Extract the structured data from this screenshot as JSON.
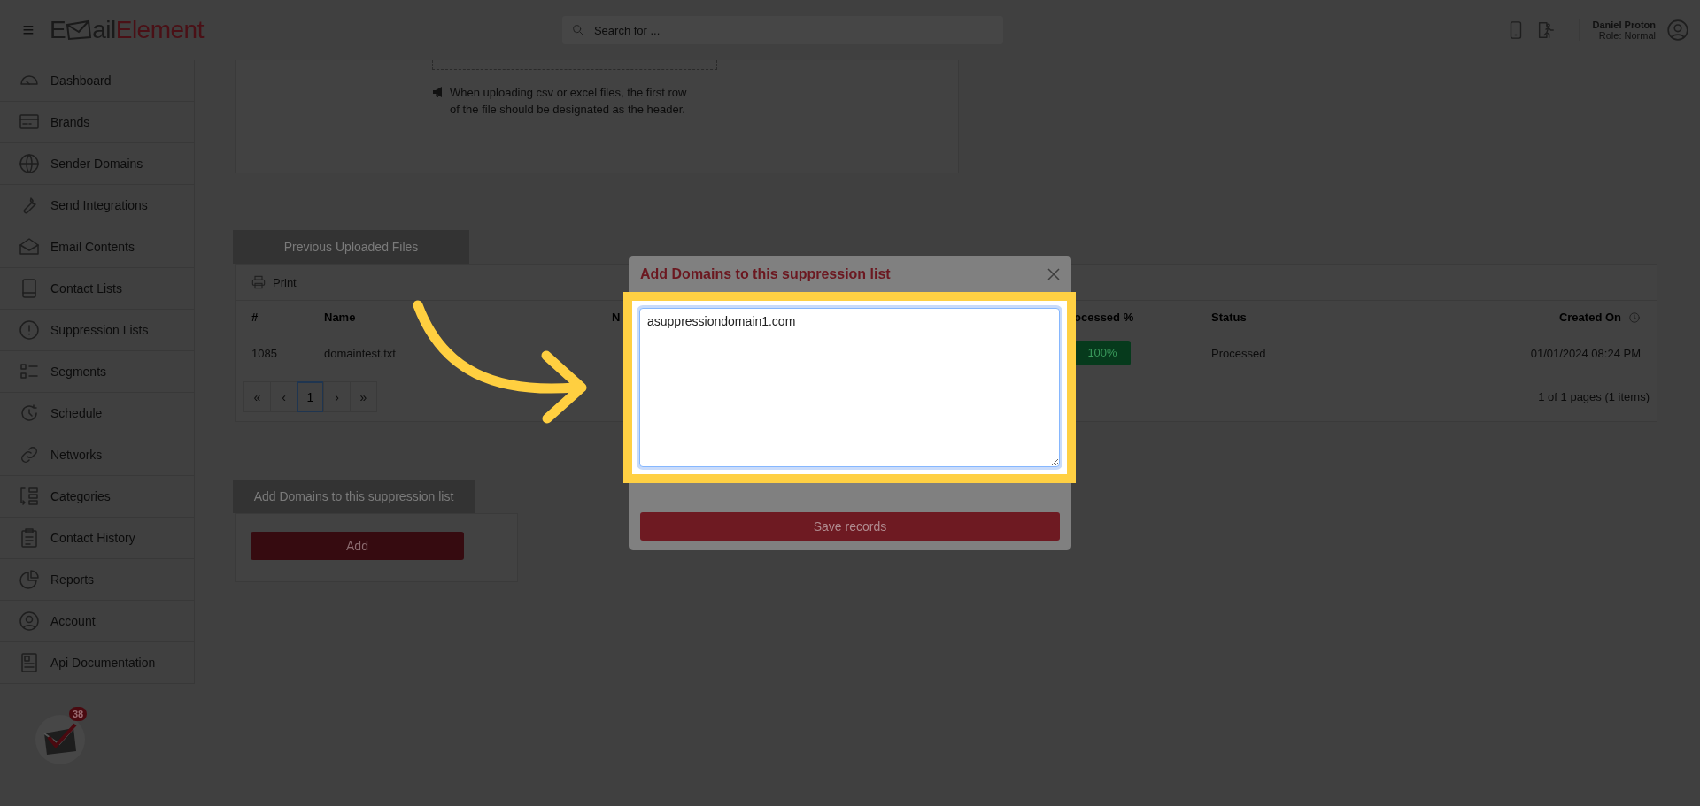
{
  "header": {
    "menu_glyph": "≡",
    "logo": {
      "first": "E",
      "middle": "ail",
      "accent": "Element"
    },
    "search": {
      "placeholder": "Search for ..."
    },
    "user": {
      "name": "Daniel Proton",
      "role": "Role: Normal"
    }
  },
  "sidebar": {
    "items": [
      {
        "label": "Dashboard"
      },
      {
        "label": "Brands"
      },
      {
        "label": "Sender Domains"
      },
      {
        "label": "Send Integrations"
      },
      {
        "label": "Email Contents"
      },
      {
        "label": "Contact Lists"
      },
      {
        "label": "Suppression Lists"
      },
      {
        "label": "Segments"
      },
      {
        "label": "Schedule"
      },
      {
        "label": "Networks"
      },
      {
        "label": "Categories"
      },
      {
        "label": "Contact History"
      },
      {
        "label": "Reports"
      },
      {
        "label": "Account"
      },
      {
        "label": "Api Documentation"
      }
    ]
  },
  "upload_card": {
    "notice": "When uploading csv or excel files, the first row of the file should be designated as the header."
  },
  "files_panel": {
    "tab": "Previous Uploaded Files",
    "print": "Print",
    "table": {
      "columns": [
        {
          "label": "#"
        },
        {
          "label": "Name"
        },
        {
          "label": "N"
        },
        {
          "label": "ocessed %"
        },
        {
          "label": "Status"
        },
        {
          "label": "Created On"
        }
      ],
      "rows": [
        {
          "id": "1085",
          "name": "domaintest.txt",
          "processed": "100%",
          "status": "Processed",
          "created_on": "01/01/2024 08:24 PM"
        }
      ]
    },
    "pagination": {
      "buttons": [
        {
          "label": "«",
          "selected": false
        },
        {
          "label": "‹",
          "selected": false
        },
        {
          "label": "1",
          "selected": true
        },
        {
          "label": "›",
          "selected": false
        },
        {
          "label": "»",
          "selected": false
        }
      ],
      "summary": "1 of 1 pages (1 items)"
    }
  },
  "add_panel": {
    "tab": "Add Domains to this suppression list",
    "button": "Add"
  },
  "modal": {
    "title": "Add Domains to this suppression list",
    "value": "asuppressiondomain1.com",
    "button": "Save records"
  },
  "notifications": {
    "badge": "38"
  }
}
